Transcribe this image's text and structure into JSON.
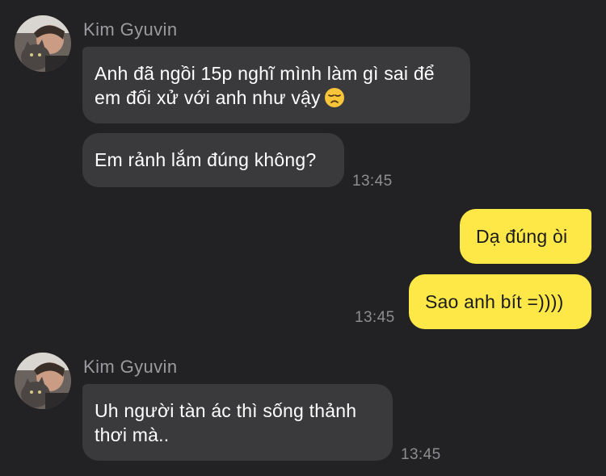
{
  "chat": {
    "groups": [
      {
        "sender": "Kim Gyuvin",
        "avatar_icon": "contact-avatar",
        "messages": [
          {
            "text": "Anh đã ngồi 15p nghĩ mình làm gì sai để em đối xử với anh như vậy",
            "emoji": "disappointed-face-emoji"
          },
          {
            "text": "Em rảnh lắm đúng không?",
            "time": "13:45"
          }
        ]
      },
      {
        "sender": "me",
        "messages": [
          {
            "text": "Dạ đúng òi"
          },
          {
            "text": "Sao anh bít =))))",
            "time": "13:45"
          }
        ]
      },
      {
        "sender": "Kim Gyuvin",
        "avatar_icon": "contact-avatar",
        "messages": [
          {
            "text": "Uh người tàn ác thì sống thảnh thơi mà..",
            "time": "13:45"
          }
        ]
      }
    ]
  },
  "colors": {
    "background": "#222224",
    "incoming_bubble": "#3a3a3c",
    "outgoing_bubble": "#fde847",
    "sender_name": "#9b9b9f",
    "timestamp": "#8e8e92"
  }
}
